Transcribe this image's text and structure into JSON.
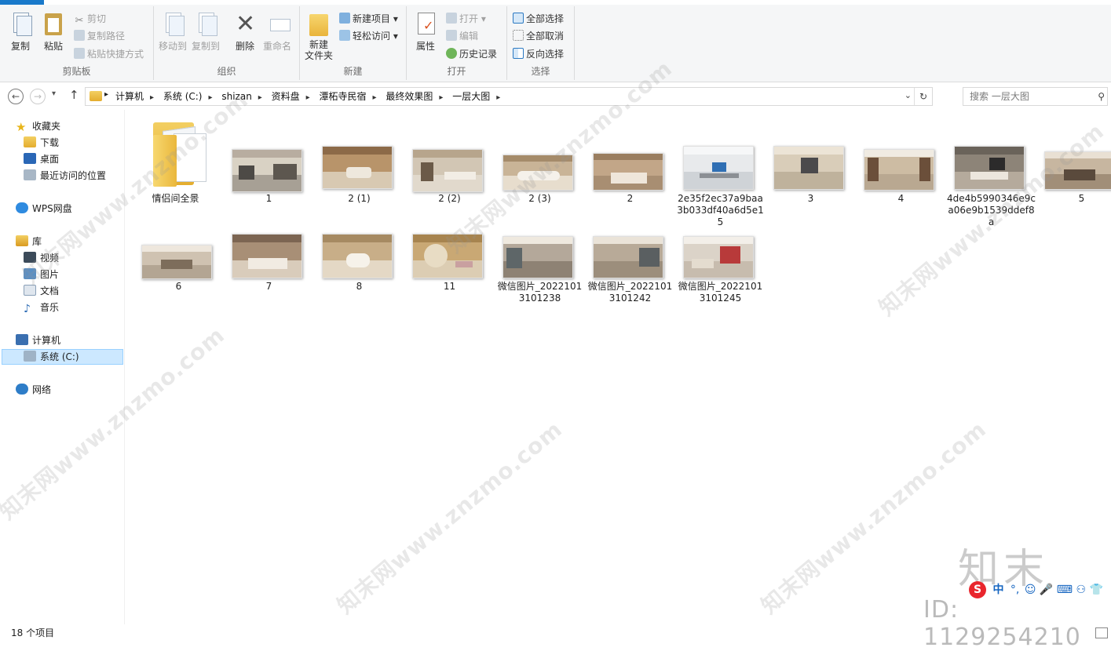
{
  "ribbon": {
    "clipboard": {
      "title": "剪贴板",
      "copy": "复制",
      "paste": "粘贴",
      "cut": "剪切",
      "copy_path": "复制路径",
      "paste_shortcut": "粘贴快捷方式"
    },
    "organize": {
      "title": "组织",
      "move_to": "移动到",
      "copy_to": "复制到",
      "delete": "删除",
      "rename": "重命名"
    },
    "new": {
      "title": "新建",
      "new_folder": "新建\n文件夹",
      "new_item": "新建项目 ▾",
      "easy_access": "轻松访问 ▾"
    },
    "open": {
      "title": "打开",
      "properties": "属性",
      "open": "打开 ▾",
      "edit": "编辑",
      "history": "历史记录"
    },
    "select": {
      "title": "选择",
      "select_all": "全部选择",
      "select_none": "全部取消",
      "invert": "反向选择"
    }
  },
  "address": {
    "crumbs": [
      "计算机",
      "系统 (C:)",
      "shizan",
      "资料盘",
      "潭柘寺民宿",
      "最终效果图",
      "一层大图"
    ],
    "search_placeholder": "搜索 一层大图"
  },
  "nav": {
    "favorites": "收藏夹",
    "downloads": "下载",
    "desktop": "桌面",
    "recent": "最近访问的位置",
    "wps": "WPS网盘",
    "libraries": "库",
    "videos": "视频",
    "pictures": "图片",
    "documents": "文档",
    "music": "音乐",
    "computer": "计算机",
    "system_c": "系统 (C:)",
    "network": "网络"
  },
  "files": [
    {
      "name": "情侣间全景",
      "type": "folder"
    },
    {
      "name": "1"
    },
    {
      "name": "2 (1)"
    },
    {
      "name": "2 (2)"
    },
    {
      "name": "2 (3)"
    },
    {
      "name": "2"
    },
    {
      "name": "2e35f2ec37a9baa3b033df40a6d5e15"
    },
    {
      "name": "3"
    },
    {
      "name": "4"
    },
    {
      "name": "4de4b5990346e9ca06e9b1539ddef8a"
    },
    {
      "name": "5"
    },
    {
      "name": "6"
    },
    {
      "name": "7"
    },
    {
      "name": "8"
    },
    {
      "name": "11"
    },
    {
      "name": "微信图片_20221013101238"
    },
    {
      "name": "微信图片_20221013101242"
    },
    {
      "name": "微信图片_20221013101245"
    }
  ],
  "status": {
    "item_count": "18 个项目"
  },
  "watermark": {
    "text": "知末网www.znzmo.com",
    "logo": "知末",
    "id": "ID: 1129254210"
  },
  "ime": {
    "mode": "中"
  }
}
